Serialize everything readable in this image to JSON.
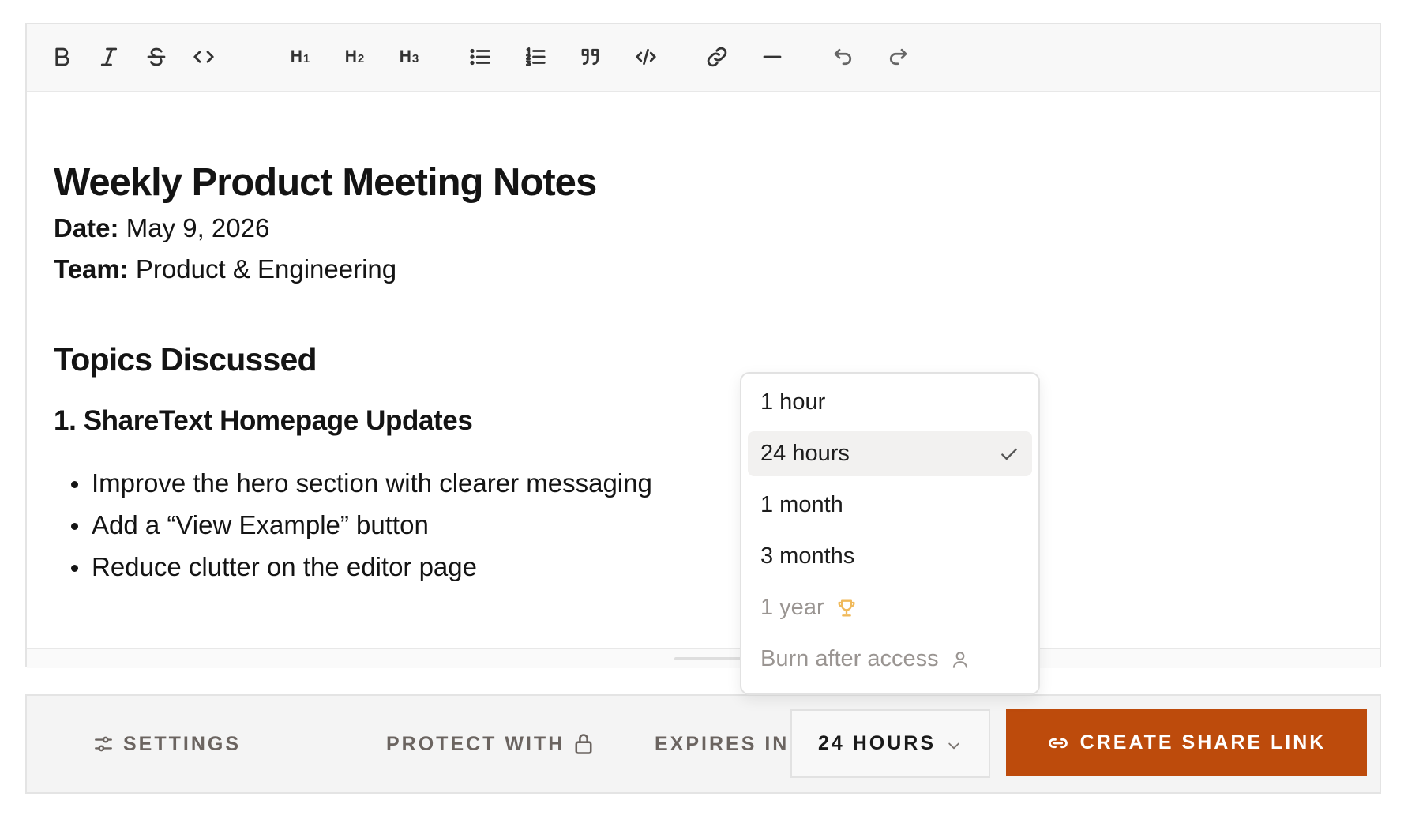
{
  "toolbar": {
    "buttons": [
      {
        "id": "bold",
        "icon": "bold-icon"
      },
      {
        "id": "italic",
        "icon": "italic-icon"
      },
      {
        "id": "strikethrough",
        "icon": "strikethrough-icon"
      },
      {
        "id": "inline-code",
        "icon": "code-icon"
      },
      {
        "id": "heading-1",
        "label": "H",
        "sub": "1"
      },
      {
        "id": "heading-2",
        "label": "H",
        "sub": "2"
      },
      {
        "id": "heading-3",
        "label": "H",
        "sub": "3"
      },
      {
        "id": "bullet-list",
        "icon": "bullet-list-icon"
      },
      {
        "id": "ordered-list",
        "icon": "ordered-list-icon"
      },
      {
        "id": "blockquote",
        "icon": "quote-icon"
      },
      {
        "id": "code-block",
        "icon": "code-block-icon"
      },
      {
        "id": "link",
        "icon": "link-icon"
      },
      {
        "id": "horizontal-rule",
        "icon": "horizontal-rule-icon"
      },
      {
        "id": "undo",
        "icon": "undo-icon"
      },
      {
        "id": "redo",
        "icon": "redo-icon"
      }
    ]
  },
  "document": {
    "title": "Weekly Product Meeting Notes",
    "date_label": "Date:",
    "date_value": " May 9, 2026",
    "team_label": "Team:",
    "team_value": " Product & Engineering",
    "section_heading": "Topics Discussed",
    "subsection_heading": "1. ShareText Homepage Updates",
    "bullets": [
      "Improve the hero section with clearer messaging",
      "Add a “View Example” button",
      "Reduce clutter on the editor page"
    ]
  },
  "footer": {
    "settings_label": "SETTINGS",
    "protect_label": "PROTECT WITH",
    "expires_label": "EXPIRES IN",
    "expires_value": "24 HOURS",
    "create_label": "CREATE SHARE LINK"
  },
  "expiry_dropdown": {
    "options": [
      {
        "label": "1 hour",
        "selected": false,
        "disabled": false
      },
      {
        "label": "24 hours",
        "selected": true,
        "disabled": false
      },
      {
        "label": "1 month",
        "selected": false,
        "disabled": false
      },
      {
        "label": "3 months",
        "selected": false,
        "disabled": false
      },
      {
        "label": "1 year",
        "selected": false,
        "disabled": true,
        "trailing_icon": "trophy-icon"
      },
      {
        "label": "Burn after access",
        "selected": false,
        "disabled": true,
        "trailing_icon": "user-icon"
      }
    ]
  },
  "colors": {
    "accent": "#bd4b0c",
    "trophy": "#f0b95a",
    "muted_text": "#6b6460"
  }
}
